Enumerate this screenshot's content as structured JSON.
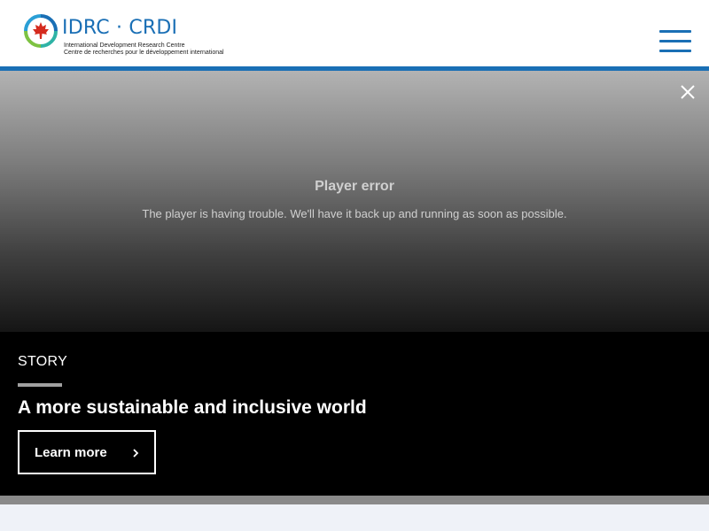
{
  "header": {
    "logo": {
      "title": "IDRC · CRDI",
      "subtitle_en": "International Development Research Centre",
      "subtitle_fr": "Centre de recherches pour le développement international"
    },
    "menu_icon": "hamburger-menu-icon"
  },
  "video": {
    "close_icon": "close-icon",
    "error_title": "Player error",
    "error_message": "The player is having trouble. We'll have it back up and running as soon as possible."
  },
  "story": {
    "kicker": "STORY",
    "headline": "A more sustainable and inclusive world",
    "cta_label": "Learn more",
    "cta_icon": "chevron-right-icon"
  },
  "colors": {
    "brand_blue": "#1a6fb5",
    "story_background": "#000000",
    "bottom_band": "#eff2f8"
  }
}
